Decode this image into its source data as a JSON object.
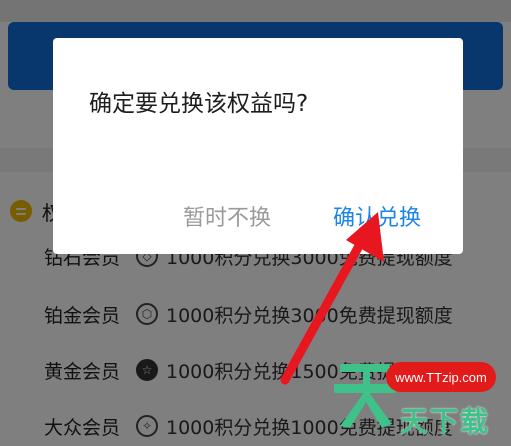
{
  "background": {
    "section_title": "权",
    "rows": [
      {
        "level": "钻石会员",
        "badge": "◇",
        "benefit": "1000积分兑换3000免费提现额度"
      },
      {
        "level": "铂金会员",
        "badge": "⬡",
        "benefit": "1000积分兑换3000免费提现额度"
      },
      {
        "level": "黄金会员",
        "badge": "☆",
        "benefit": "1000积分兑换1500免费提现额度"
      },
      {
        "level": "大众会员",
        "badge": "✧",
        "benefit": "1000积分兑换1000免费提现额度"
      }
    ]
  },
  "dialog": {
    "message": "确定要兑换该权益吗?",
    "cancel_label": "暂时不换",
    "confirm_label": "确认兑换"
  },
  "watermark": {
    "url": "www.TTzip.com",
    "brand": "天下载"
  },
  "colors": {
    "top_button": "#0f6fd9",
    "confirm": "#1a85e8",
    "cancel": "#9a9a9a",
    "arrow": "#e8161f",
    "watermark_green": "#3fc28a",
    "watermark_red": "#e21a1a"
  }
}
